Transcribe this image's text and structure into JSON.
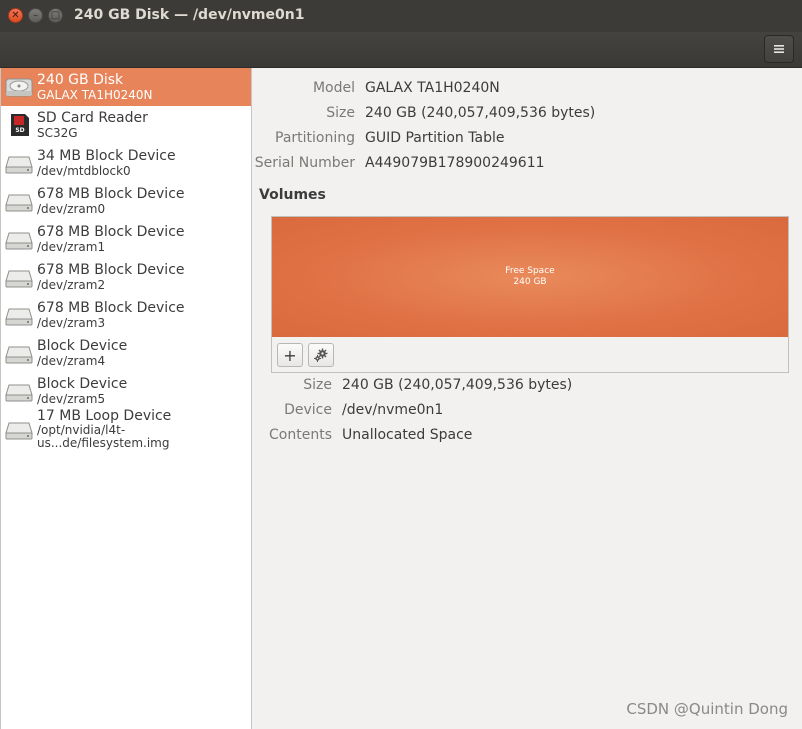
{
  "window": {
    "title": "240 GB Disk — /dev/nvme0n1"
  },
  "devices": [
    {
      "name": "240 GB Disk",
      "sub": "GALAX TA1H0240N",
      "icon": "hdd-icon",
      "selected": true
    },
    {
      "name": "SD Card Reader",
      "sub": "SC32G",
      "icon": "sd-card-icon",
      "selected": false
    },
    {
      "name": "34 MB Block Device",
      "sub": "/dev/mtdblock0",
      "icon": "drive-icon",
      "selected": false
    },
    {
      "name": "678 MB Block Device",
      "sub": "/dev/zram0",
      "icon": "drive-icon",
      "selected": false
    },
    {
      "name": "678 MB Block Device",
      "sub": "/dev/zram1",
      "icon": "drive-icon",
      "selected": false
    },
    {
      "name": "678 MB Block Device",
      "sub": "/dev/zram2",
      "icon": "drive-icon",
      "selected": false
    },
    {
      "name": "678 MB Block Device",
      "sub": "/dev/zram3",
      "icon": "drive-icon",
      "selected": false
    },
    {
      "name": "Block Device",
      "sub": "/dev/zram4",
      "icon": "drive-icon",
      "selected": false
    },
    {
      "name": "Block Device",
      "sub": "/dev/zram5",
      "icon": "drive-icon",
      "selected": false
    },
    {
      "name": "17 MB Loop Device",
      "sub": "/opt/nvidia/l4t-us...de/filesystem.img",
      "icon": "drive-icon",
      "selected": false
    }
  ],
  "disk_info": {
    "model_label": "Model",
    "model": "GALAX TA1H0240N",
    "size_label": "Size",
    "size": "240 GB (240,057,409,536 bytes)",
    "partitioning_label": "Partitioning",
    "partitioning": "GUID Partition Table",
    "serial_label": "Serial Number",
    "serial": "A449079B178900249611"
  },
  "volumes": {
    "title": "Volumes",
    "segment_label": "Free Space",
    "segment_size": "240 GB",
    "add_button": "+",
    "settings_icon": "gears-icon"
  },
  "volume_info": {
    "size_label": "Size",
    "size": "240 GB (240,057,409,536 bytes)",
    "device_label": "Device",
    "device": "/dev/nvme0n1",
    "contents_label": "Contents",
    "contents": "Unallocated Space"
  },
  "watermark": "CSDN @Quintin Dong",
  "colors": {
    "selection": "#e8845a",
    "free_space": "#df7145",
    "titlebar": "#3c3b37"
  }
}
